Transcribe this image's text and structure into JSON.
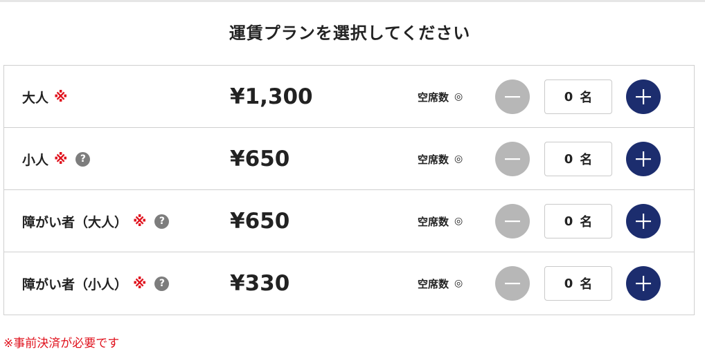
{
  "title": "運賃プランを選択してください",
  "rows": [
    {
      "name": "大人",
      "required_mark": "※",
      "help": "",
      "price": "¥1,300",
      "seats_label": "空席数",
      "seats_status": "◎",
      "quantity": "0",
      "unit": "名"
    },
    {
      "name": "小人",
      "required_mark": "※",
      "help": "?",
      "price": "¥650",
      "seats_label": "空席数",
      "seats_status": "◎",
      "quantity": "0",
      "unit": "名"
    },
    {
      "name": "障がい者（大人）",
      "required_mark": "※",
      "help": "?",
      "price": "¥650",
      "seats_label": "空席数",
      "seats_status": "◎",
      "quantity": "0",
      "unit": "名"
    },
    {
      "name": "障がい者（小人）",
      "required_mark": "※",
      "help": "?",
      "price": "¥330",
      "seats_label": "空席数",
      "seats_status": "◎",
      "quantity": "0",
      "unit": "名"
    }
  ],
  "note": "※事前決済が必要です",
  "colors": {
    "accent": "#1c2d6e",
    "disabled": "#b7b7b7",
    "required": "#e0111c",
    "help": "#7d7d7d"
  },
  "icons": {
    "minus": "minus-icon",
    "plus": "plus-icon",
    "help": "question-circle-icon"
  }
}
